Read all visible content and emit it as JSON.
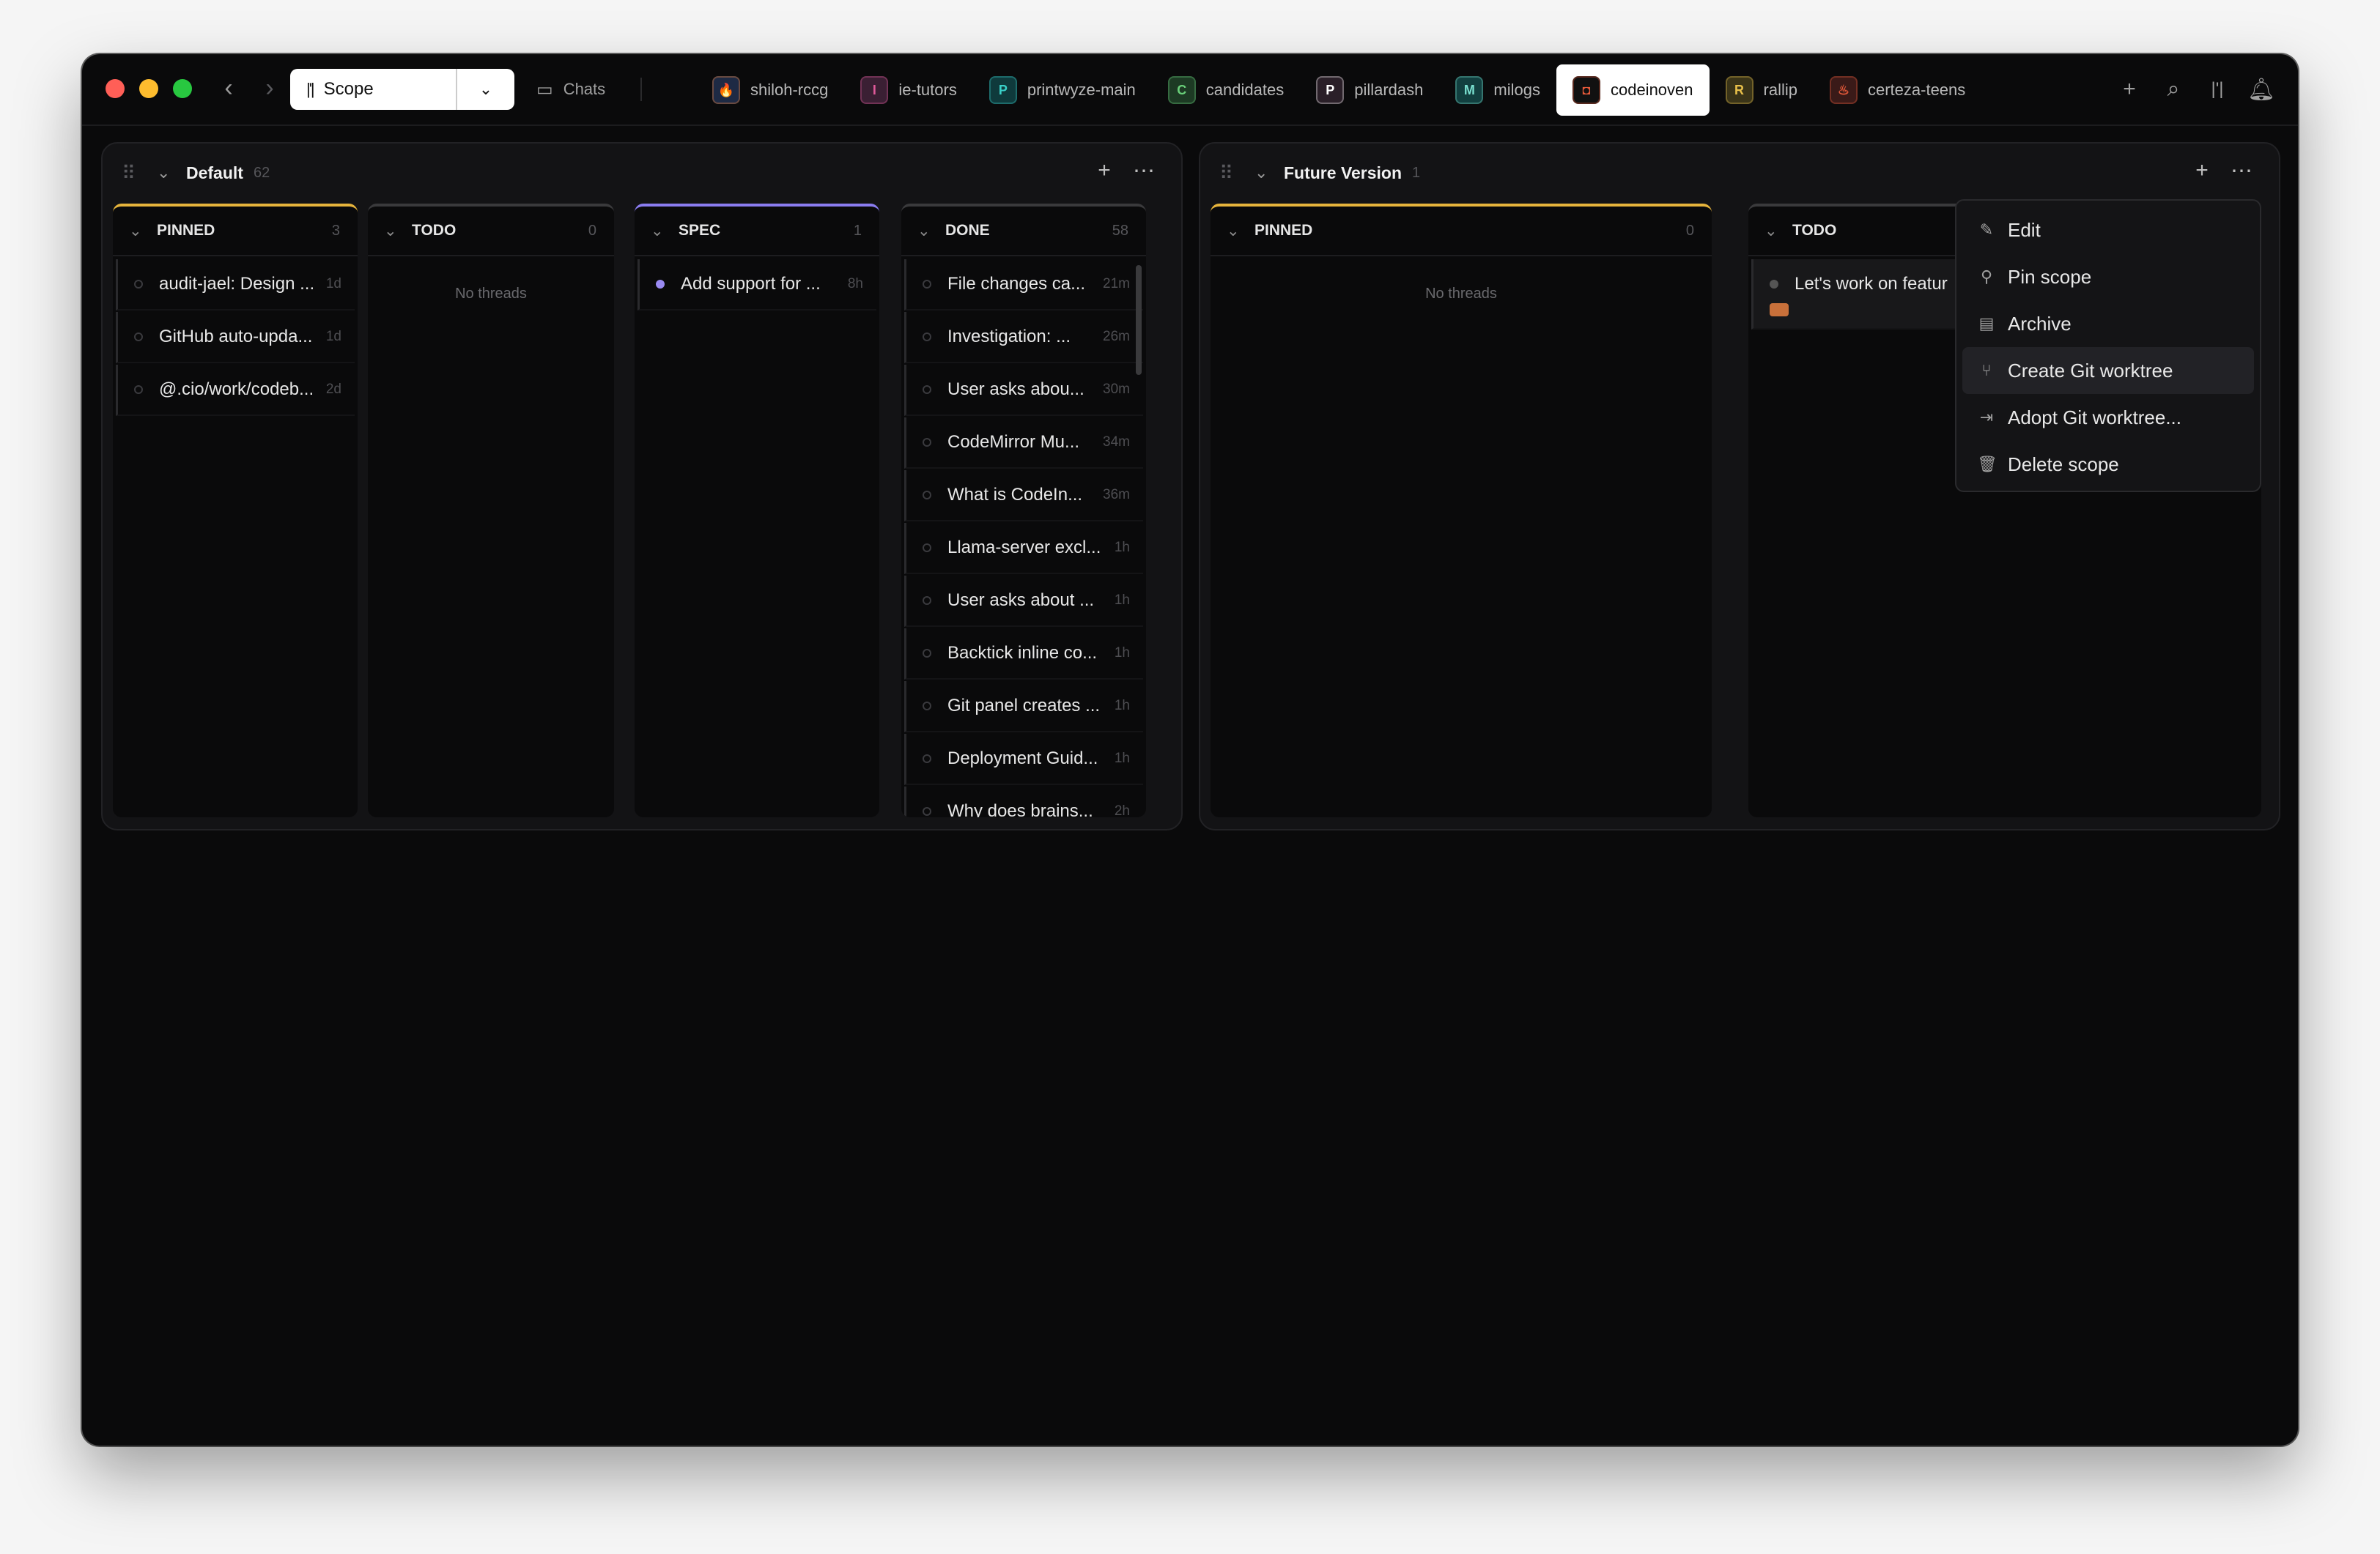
{
  "titlebar": {
    "scope_label": "Scope",
    "chats_label": "Chats",
    "tabs": [
      {
        "label": "shiloh-rccg",
        "icon_char": "🔥",
        "icon_bg": "#1e2a44",
        "icon_fg": "#ff8a3d",
        "active": false
      },
      {
        "label": "ie-tutors",
        "icon_char": "I",
        "icon_bg": "#3a1f33",
        "icon_fg": "#e05a9a",
        "active": false
      },
      {
        "label": "printwyze-main",
        "icon_char": "P",
        "icon_bg": "#0f3a3c",
        "icon_fg": "#3ad0c8",
        "active": false
      },
      {
        "label": "candidates",
        "icon_char": "C",
        "icon_bg": "#1d3a24",
        "icon_fg": "#6ad07a",
        "active": false
      },
      {
        "label": "pillardash",
        "icon_char": "P",
        "icon_bg": "#2a1f28",
        "icon_fg": "#ffffff",
        "active": false
      },
      {
        "label": "milogs",
        "icon_char": "M",
        "icon_bg": "#124040",
        "icon_fg": "#7ae0d0",
        "active": false
      },
      {
        "label": "codeinoven",
        "icon_char": "◘",
        "icon_bg": "#111111",
        "icon_fg": "#e85a3a",
        "active": true
      },
      {
        "label": "rallip",
        "icon_char": "R",
        "icon_bg": "#3a3418",
        "icon_fg": "#e8c04a",
        "active": false
      },
      {
        "label": "certeza-teens",
        "icon_char": "♨",
        "icon_bg": "#3a1a18",
        "icon_fg": "#e85a3a",
        "active": false
      }
    ]
  },
  "panels": [
    {
      "title": "Default",
      "count": "62",
      "columns": [
        {
          "name": "PINNED",
          "count": "3",
          "items": [
            {
              "title": "audit-jael: Design ...",
              "time": "1d"
            },
            {
              "title": "GitHub auto-upda...",
              "time": "1d"
            },
            {
              "title": "@.cio/work/codeb...",
              "time": "2d"
            }
          ]
        },
        {
          "name": "TODO",
          "count": "0",
          "empty": "No threads"
        },
        {
          "name": "SPEC",
          "count": "1",
          "items": [
            {
              "title": "Add support for ...",
              "time": "8h"
            }
          ]
        },
        {
          "name": "DONE",
          "count": "58",
          "items": [
            {
              "title": "File changes ca...",
              "time": "21m"
            },
            {
              "title": "Investigation: ...",
              "time": "26m"
            },
            {
              "title": "User asks abou...",
              "time": "30m"
            },
            {
              "title": "CodeMirror Mu...",
              "time": "34m"
            },
            {
              "title": "What is CodeIn...",
              "time": "36m"
            },
            {
              "title": "Llama-server excl...",
              "time": "1h"
            },
            {
              "title": "User asks about ...",
              "time": "1h"
            },
            {
              "title": "Backtick inline co...",
              "time": "1h"
            },
            {
              "title": "Git panel creates ...",
              "time": "1h"
            },
            {
              "title": "Deployment Guid...",
              "time": "1h"
            },
            {
              "title": "Why does brains...",
              "time": "2h"
            }
          ]
        }
      ]
    },
    {
      "title": "Future Version",
      "count": "1",
      "columns": [
        {
          "name": "PINNED",
          "count": "0",
          "empty": "No threads"
        },
        {
          "name": "TODO",
          "count": "",
          "items": [
            {
              "title": "Let's work on featur",
              "time": ""
            }
          ]
        }
      ]
    }
  ],
  "context_menu": {
    "items": [
      {
        "label": "Edit",
        "icon": "pencil-icon"
      },
      {
        "label": "Pin scope",
        "icon": "pin-icon"
      },
      {
        "label": "Archive",
        "icon": "archive-icon"
      },
      {
        "label": "Create Git worktree",
        "icon": "git-branch-icon"
      },
      {
        "label": "Adopt Git worktree...",
        "icon": "folder-import-icon"
      },
      {
        "label": "Delete scope",
        "icon": "trash-icon"
      }
    ]
  },
  "colors": {
    "pinned_accent": "#e6b43c",
    "spec_accent": "#8a7cf0",
    "window_bg": "#0a0a0b"
  }
}
